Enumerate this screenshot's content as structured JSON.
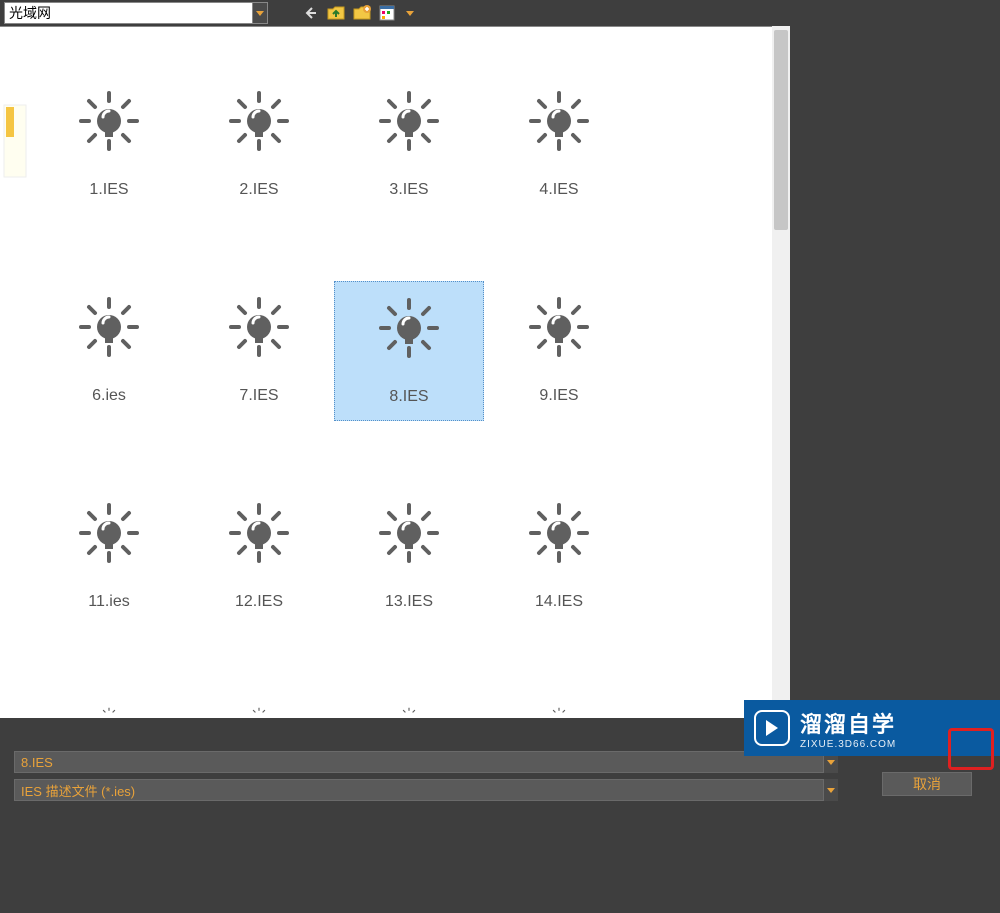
{
  "toolbar": {
    "path_value": "光域网",
    "tooltips": {
      "back": "返回",
      "up": "上级目录",
      "newfolder": "新建文件夹",
      "viewmode": "视图模式"
    }
  },
  "files": {
    "items": [
      {
        "name": "1.IES",
        "selected": false
      },
      {
        "name": "2.IES",
        "selected": false
      },
      {
        "name": "3.IES",
        "selected": false
      },
      {
        "name": "4.IES",
        "selected": false
      },
      {
        "name": "6.ies",
        "selected": false
      },
      {
        "name": "7.IES",
        "selected": false
      },
      {
        "name": "8.IES",
        "selected": true
      },
      {
        "name": "9.IES",
        "selected": false
      },
      {
        "name": "11.ies",
        "selected": false
      },
      {
        "name": "12.IES",
        "selected": false
      },
      {
        "name": "13.IES",
        "selected": false
      },
      {
        "name": "14.IES",
        "selected": false
      }
    ]
  },
  "bottom": {
    "filename_value": "8.IES",
    "filter_value": "IES 描述文件 (*.ies)",
    "cancel_label": "取消"
  },
  "watermark": {
    "title": "溜溜自学",
    "sub": "ZIXUE.3D66.COM"
  }
}
